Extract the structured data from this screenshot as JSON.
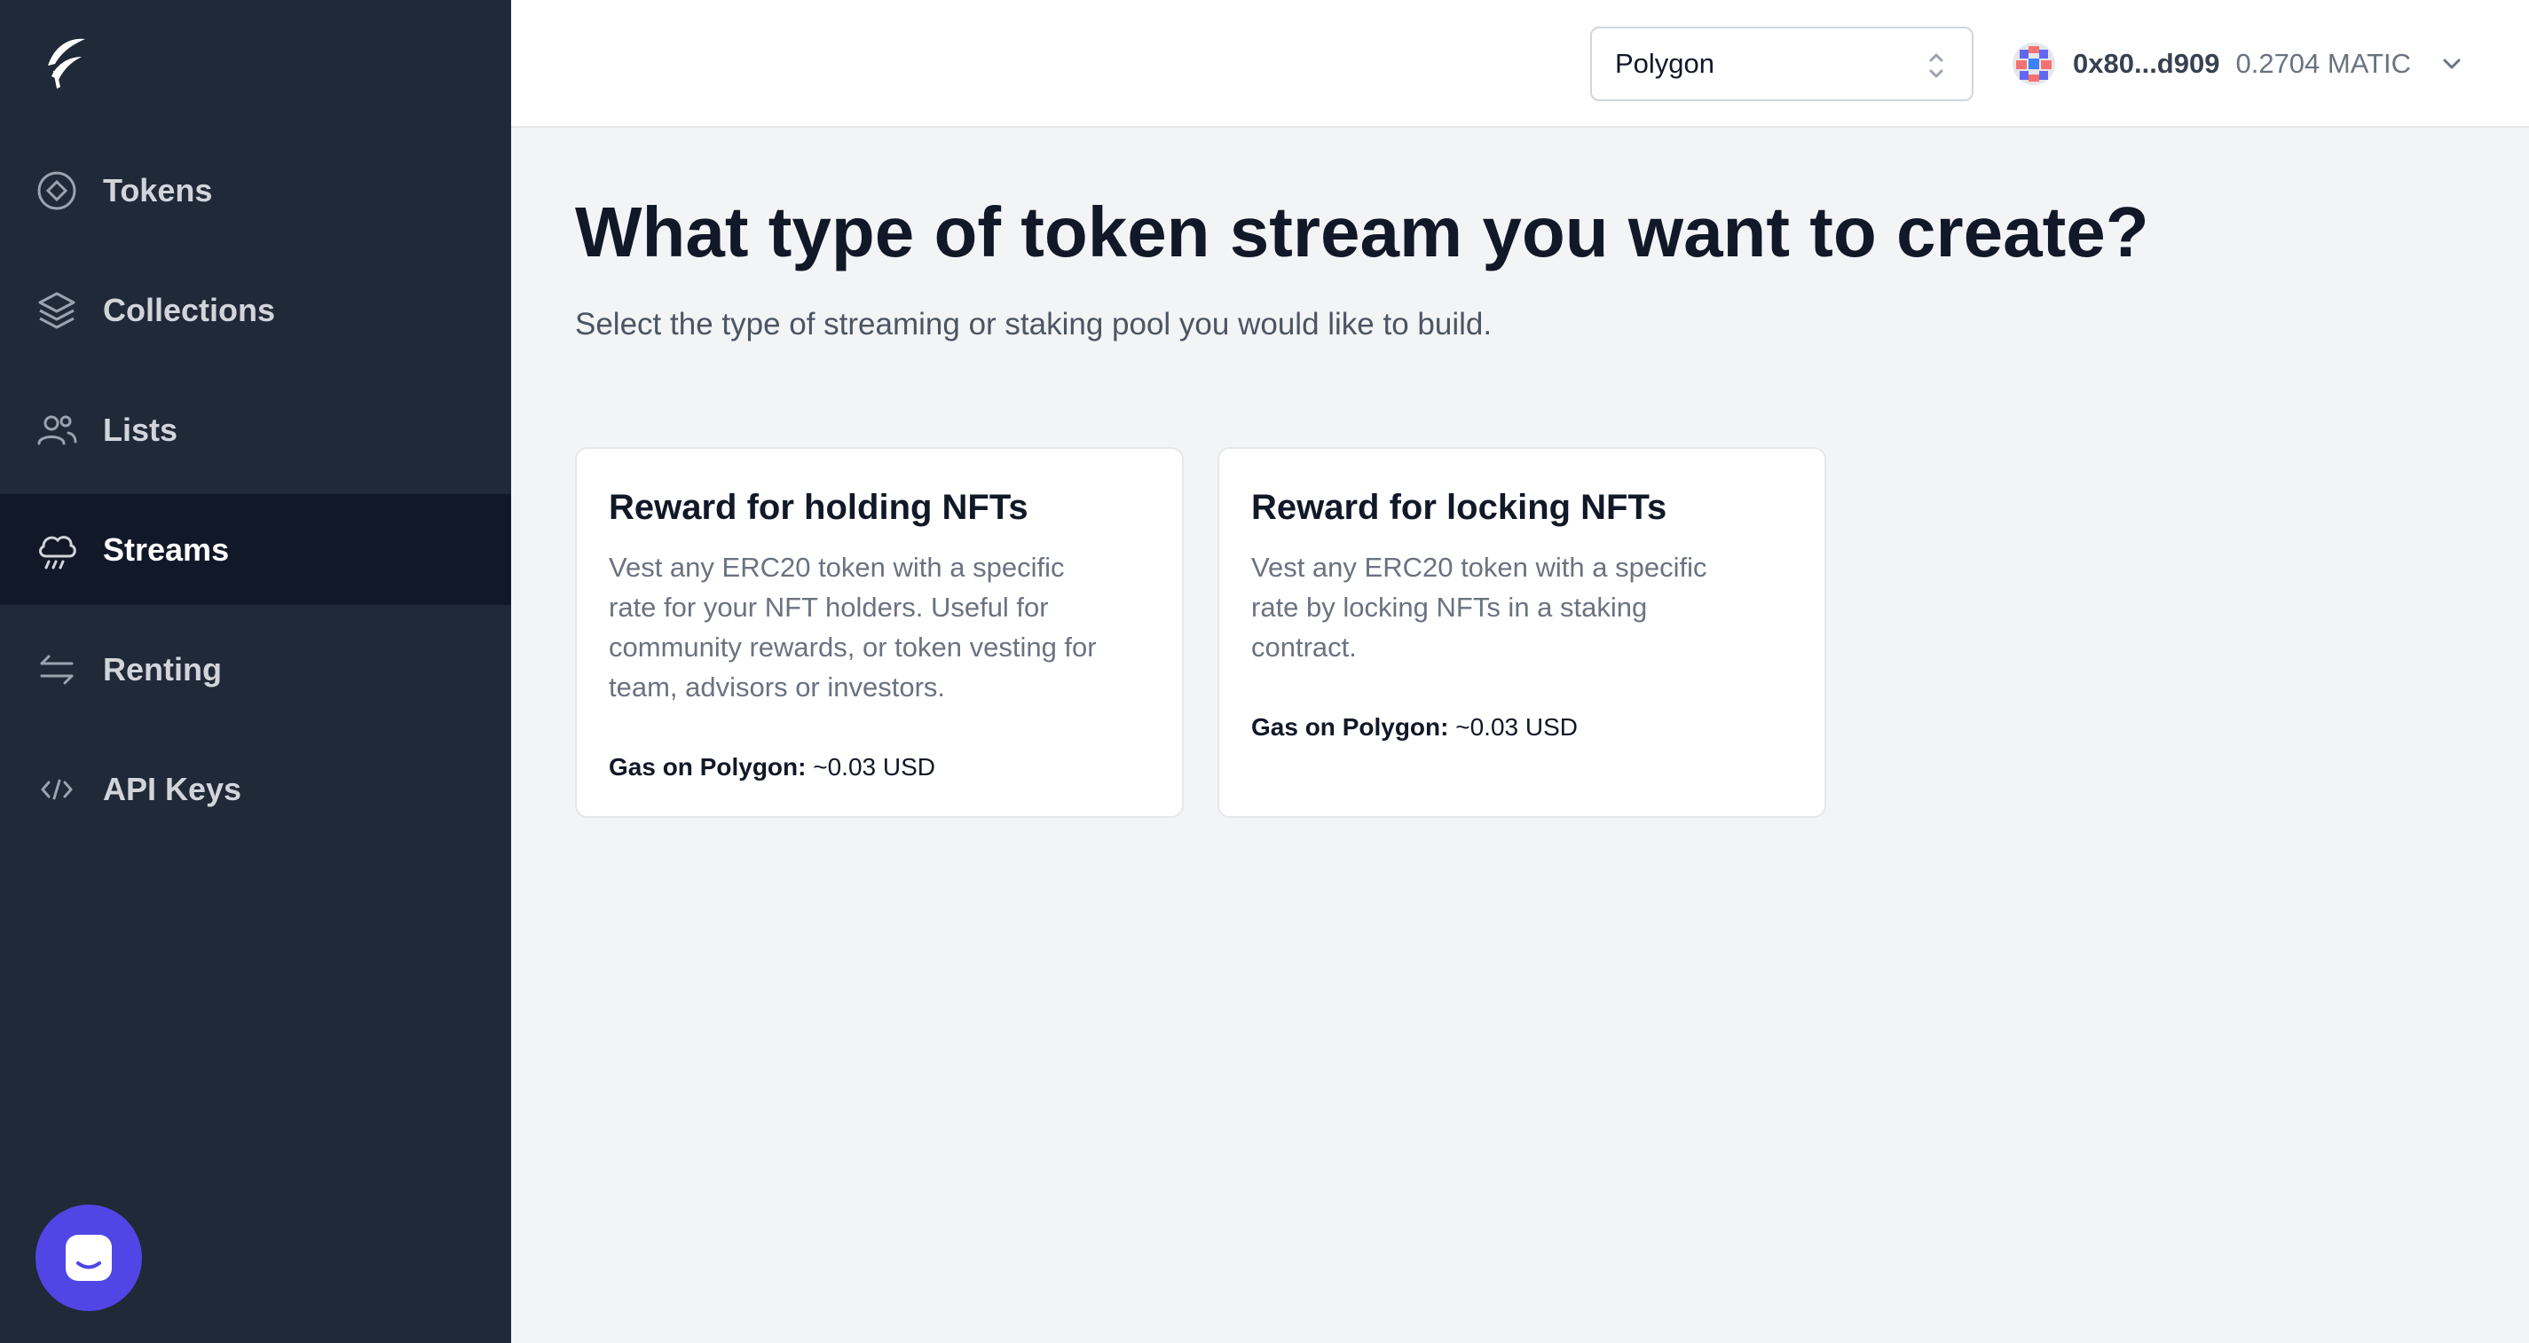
{
  "sidebar": {
    "items": [
      {
        "label": "Tokens",
        "icon": "tokens-icon",
        "active": false
      },
      {
        "label": "Collections",
        "icon": "layers-icon",
        "active": false
      },
      {
        "label": "Lists",
        "icon": "users-icon",
        "active": false
      },
      {
        "label": "Streams",
        "icon": "cloud-rain-icon",
        "active": true
      },
      {
        "label": "Renting",
        "icon": "switch-arrows-icon",
        "active": false
      },
      {
        "label": "API Keys",
        "icon": "code-icon",
        "active": false
      }
    ]
  },
  "header": {
    "network": {
      "selected": "Polygon"
    },
    "wallet": {
      "address": "0x80...d909",
      "balance": "0.2704 MATIC"
    }
  },
  "main": {
    "title": "What type of token stream you want to create?",
    "subtitle": "Select the type of streaming or staking pool you would like to build.",
    "cards": [
      {
        "title": "Reward for holding NFTs",
        "description": "Vest any ERC20 token with a specific rate for your NFT holders. Useful for community rewards, or token vesting for team, advisors or investors.",
        "gas_label": "Gas on Polygon:",
        "gas_value": "~0.03 USD"
      },
      {
        "title": "Reward for locking NFTs",
        "description": "Vest any ERC20 token with a specific rate by locking NFTs in a staking contract.",
        "gas_label": "Gas on Polygon:",
        "gas_value": "~0.03 USD"
      }
    ]
  },
  "colors": {
    "sidebar_bg": "#1f2937",
    "sidebar_active_bg": "#111827",
    "accent": "#4f46e5",
    "page_bg": "#f3f4f6"
  }
}
